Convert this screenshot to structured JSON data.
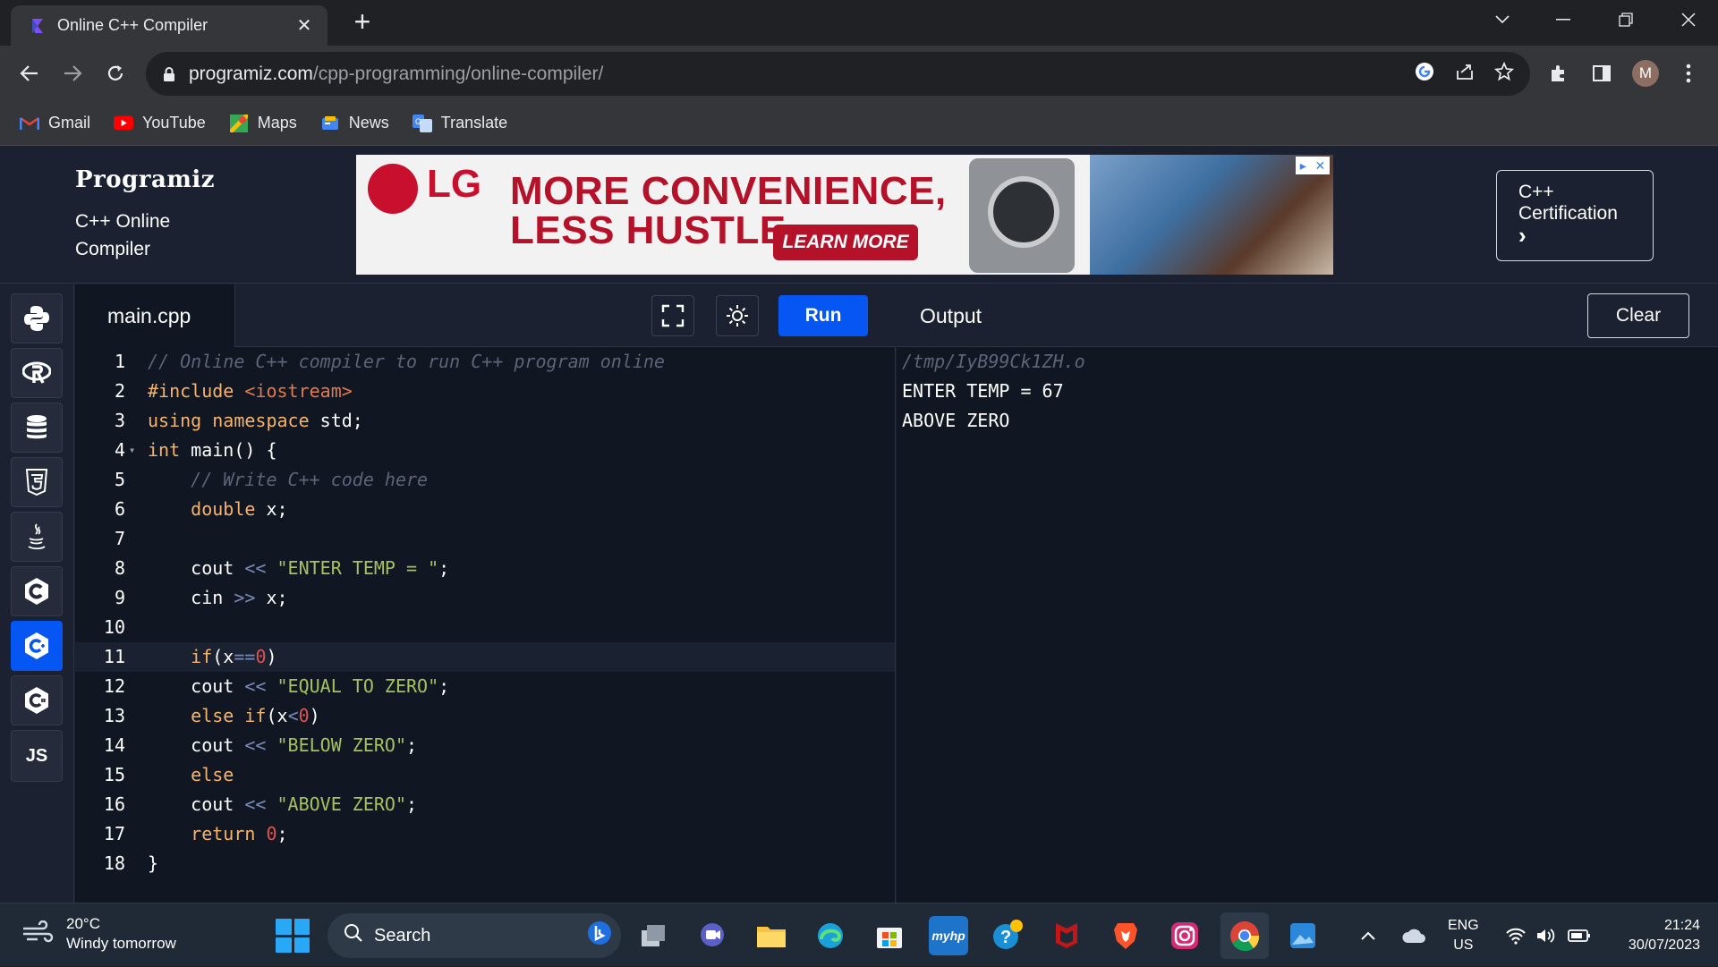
{
  "browser": {
    "tab_title": "Online C++ Compiler",
    "url_host": "programiz.com",
    "url_path": "/cpp-programming/online-compiler/",
    "profile_initial": "M",
    "bookmarks": [
      {
        "label": "Gmail"
      },
      {
        "label": "YouTube"
      },
      {
        "label": "Maps"
      },
      {
        "label": "News"
      },
      {
        "label": "Translate"
      }
    ]
  },
  "header": {
    "logo": "Programiz",
    "subtitle": "C++ Online Compiler",
    "certification_label": "C++ Certification",
    "certification_arrow": "›"
  },
  "ad": {
    "brand": "LG",
    "headline_1": "MORE CONVENIENCE,",
    "headline_2": "LESS HUSTLE",
    "cta": "LEARN MORE"
  },
  "sidebar": {
    "languages": [
      {
        "name": "python",
        "glyph": "🐍"
      },
      {
        "name": "r",
        "glyph": "R"
      },
      {
        "name": "sql",
        "glyph": "≡"
      },
      {
        "name": "html",
        "glyph": "5"
      },
      {
        "name": "java",
        "glyph": "♨"
      },
      {
        "name": "c",
        "glyph": "C"
      },
      {
        "name": "cpp",
        "glyph": "C+"
      },
      {
        "name": "csharp",
        "glyph": "C#"
      },
      {
        "name": "javascript",
        "glyph": "JS"
      }
    ],
    "active": "cpp"
  },
  "editor": {
    "file_name": "main.cpp",
    "run_label": "Run",
    "active_line": 11,
    "line_numbers": [
      "1",
      "2",
      "3",
      "4",
      "5",
      "6",
      "7",
      "8",
      "9",
      "10",
      "11",
      "12",
      "13",
      "14",
      "15",
      "16",
      "17",
      "18"
    ]
  },
  "output": {
    "title": "Output",
    "clear_label": "Clear",
    "lines": [
      "/tmp/IyB99Ck1ZH.o",
      "ENTER TEMP = 67",
      "ABOVE ZERO"
    ]
  },
  "taskbar": {
    "weather_temp": "20°C",
    "weather_desc": "Windy tomorrow",
    "search_placeholder": "Search",
    "lang_1": "ENG",
    "lang_2": "US",
    "time": "21:24",
    "date": "30/07/2023"
  },
  "colors": {
    "accent": "#0556f3",
    "page_bg": "#1b2131",
    "editor_bg": "#111722"
  }
}
